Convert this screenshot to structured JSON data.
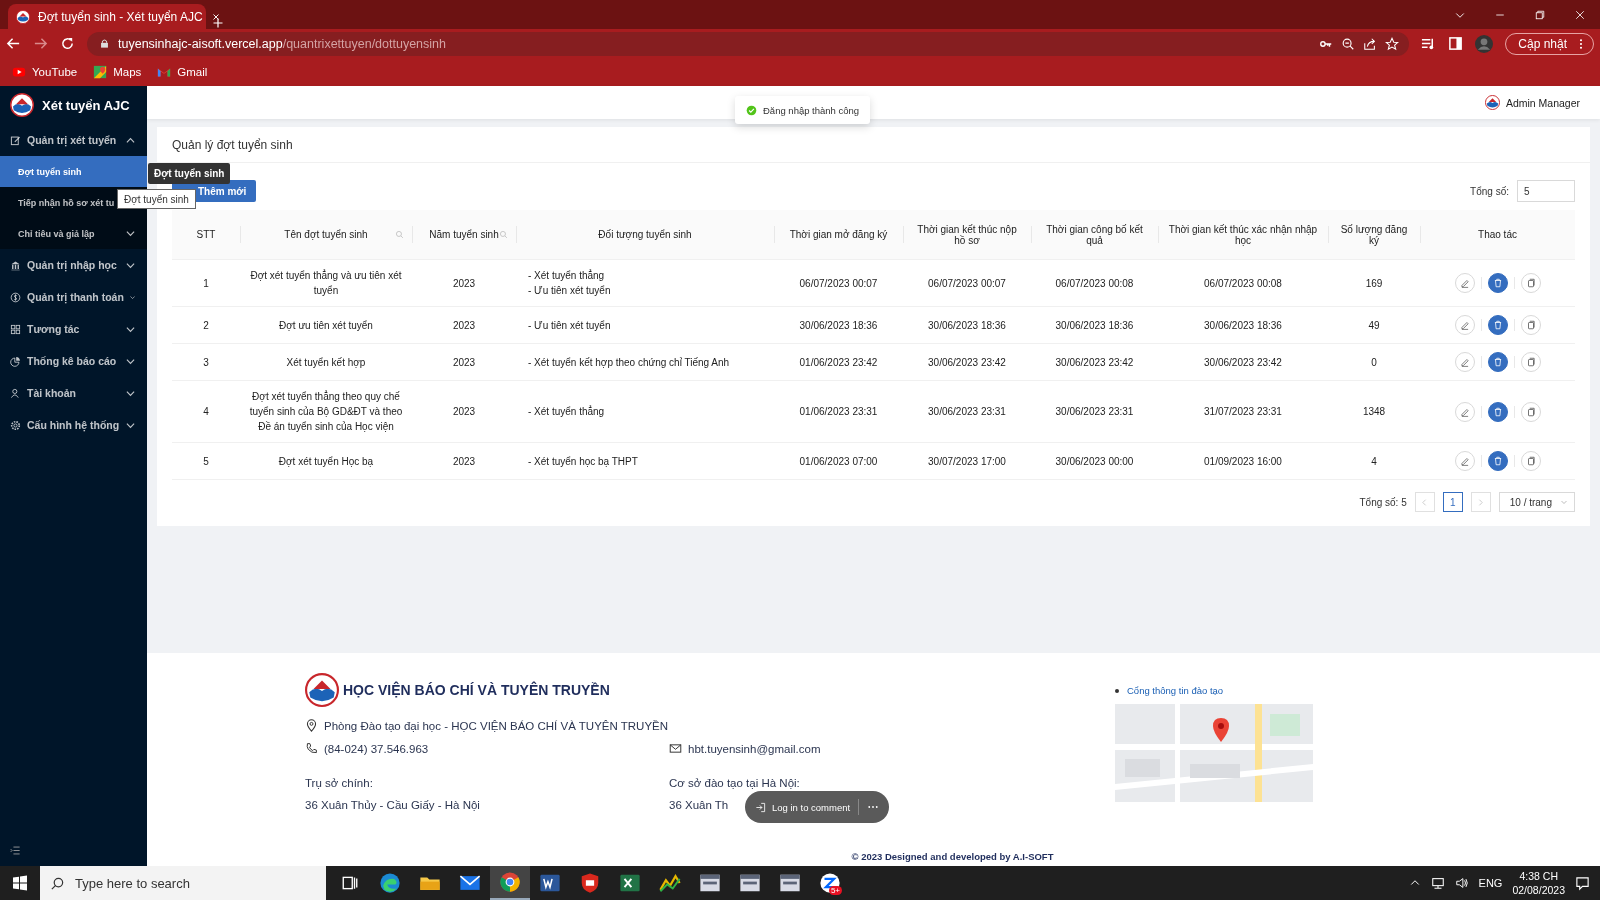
{
  "browser": {
    "tab_title": "Đợt tuyển sinh - Xét tuyển AJC",
    "url_host": "tuyensinhajc-aisoft.vercel.app",
    "url_path": "/quantrixettuyen/dottuyensinh",
    "update_button": "Cập nhật",
    "bookmarks": [
      {
        "label": "YouTube",
        "kind": "youtube"
      },
      {
        "label": "Maps",
        "kind": "maps"
      },
      {
        "label": "Gmail",
        "kind": "gmail"
      }
    ]
  },
  "sidebar": {
    "brand": "Xét tuyển AJC",
    "items": [
      {
        "label": "Quản trị xét tuyển",
        "expanded": true,
        "children": [
          {
            "label": "Đợt tuyển sinh",
            "selected": true,
            "kind": "link"
          },
          {
            "label": "Tiếp nhận hồ sơ xét tu",
            "selected": false,
            "kind": "link"
          },
          {
            "label": "Chỉ tiêu và giả lập",
            "selected": false,
            "kind": "submenu",
            "expanded": false
          }
        ]
      },
      {
        "label": "Quản trị nhập học",
        "expanded": false
      },
      {
        "label": "Quản trị thanh toán",
        "expanded": false
      },
      {
        "label": "Tương tác",
        "expanded": false
      },
      {
        "label": "Thống kê báo cáo",
        "expanded": false
      },
      {
        "label": "Tài khoản",
        "expanded": false
      },
      {
        "label": "Cấu hình hệ thống",
        "expanded": false
      }
    ]
  },
  "menu_tooltip": {
    "text": "Đợt tuyển sinh"
  },
  "title_tooltip": {
    "text": "Đợt tuyển sinh"
  },
  "toast": {
    "text": "Đăng nhập thành công"
  },
  "header": {
    "user": "Admin Manager"
  },
  "card": {
    "title": "Quản lý đợt tuyển sinh",
    "add_button": "Thêm mới",
    "total_label": "Tổng số:",
    "total_value": "5",
    "table": {
      "columns": [
        {
          "label": "STT",
          "searchable": false
        },
        {
          "label": "Tên đợt tuyển sinh",
          "searchable": true
        },
        {
          "label": "Năm tuyển sinh",
          "searchable": true
        },
        {
          "label": "Đối tượng tuyển sinh",
          "searchable": false
        },
        {
          "label": "Thời gian mở đăng ký",
          "searchable": false
        },
        {
          "label": "Thời gian kết thúc nộp hồ sơ",
          "searchable": false
        },
        {
          "label": "Thời gian công bố kết quả",
          "searchable": false
        },
        {
          "label": "Thời gian kết thúc xác nhận nhập học",
          "searchable": false
        },
        {
          "label": "Số lượng đăng ký",
          "searchable": false
        },
        {
          "label": "Thao tác",
          "searchable": false
        }
      ],
      "rows": [
        {
          "stt": "1",
          "name": "Đợt xét tuyển thẳng và ưu tiên xét tuyển",
          "year": "2023",
          "targets": [
            "- Xét tuyển thẳng",
            "- Ưu tiên xét tuyển"
          ],
          "open": "06/07/2023 00:07",
          "submit_end": "06/07/2023 00:07",
          "announce": "06/07/2023 00:08",
          "confirm_end": "06/07/2023 00:08",
          "count": "169"
        },
        {
          "stt": "2",
          "name": "Đợt ưu tiên xét tuyển",
          "year": "2023",
          "targets": [
            "- Ưu tiên xét tuyển"
          ],
          "open": "30/06/2023 18:36",
          "submit_end": "30/06/2023 18:36",
          "announce": "30/06/2023 18:36",
          "confirm_end": "30/06/2023 18:36",
          "count": "49"
        },
        {
          "stt": "3",
          "name": "Xét tuyển kết hợp",
          "year": "2023",
          "targets": [
            "- Xét tuyển kết hợp theo chứng chỉ Tiếng Anh"
          ],
          "open": "01/06/2023 23:42",
          "submit_end": "30/06/2023 23:42",
          "announce": "30/06/2023 23:42",
          "confirm_end": "30/06/2023 23:42",
          "count": "0"
        },
        {
          "stt": "4",
          "name": "Đợt xét tuyển thẳng theo quy chế tuyển sinh của Bộ GD&ĐT và theo Đề án tuyển sinh của Học viện",
          "year": "2023",
          "targets": [
            "- Xét tuyển thẳng"
          ],
          "open": "01/06/2023 23:31",
          "submit_end": "30/06/2023 23:31",
          "announce": "30/06/2023 23:31",
          "confirm_end": "31/07/2023 23:31",
          "count": "1348"
        },
        {
          "stt": "5",
          "name": "Đợt xét tuyển Học bạ",
          "year": "2023",
          "targets": [
            "- Xét tuyển học bạ THPT"
          ],
          "open": "01/06/2023 07:00",
          "submit_end": "30/07/2023 17:00",
          "announce": "30/06/2023 00:00",
          "confirm_end": "01/09/2023 16:00",
          "count": "4"
        }
      ]
    },
    "pagination": {
      "total_text": "Tổng số: 5",
      "pages": [
        {
          "label": "1",
          "selected": true
        }
      ],
      "page_size": "10 / trang"
    }
  },
  "footer": {
    "org": "HỌC VIỆN BÁO CHÍ VÀ TUYÊN TRUYỀN",
    "address": "Phòng Đào tạo đại học - HỌC VIỆN BÁO CHÍ VÀ TUYÊN TRUYỀN",
    "phone": "(84-024) 37.546.963",
    "email": "hbt.tuyensinh@gmail.com",
    "head_office_label": "Trụ sở chính:",
    "head_office": "36 Xuân Thủy - Cầu Giấy - Hà Nội",
    "campus_label": "Cơ sở đào tạo tại Hà Nội:",
    "campus": "36 Xuân Th",
    "portal_link": "Cổng thông tin đào tạo",
    "copyright": "© 2023 Designed and developed by A.I-SOFT"
  },
  "comment_pill": {
    "text": "Log in to comment"
  },
  "taskbar": {
    "search_placeholder": "Type here to search",
    "apps": [
      {
        "kind": "taskview",
        "selected": false
      },
      {
        "kind": "edge",
        "selected": false
      },
      {
        "kind": "explorer",
        "selected": false
      },
      {
        "kind": "mail",
        "selected": false
      },
      {
        "kind": "chrome",
        "selected": true
      },
      {
        "kind": "word",
        "selected": false
      },
      {
        "kind": "shield",
        "selected": false
      },
      {
        "kind": "excel",
        "selected": false
      },
      {
        "kind": "chart",
        "selected": false
      },
      {
        "kind": "window",
        "selected": false
      },
      {
        "kind": "window",
        "selected": false
      },
      {
        "kind": "window",
        "selected": false
      },
      {
        "kind": "chat",
        "selected": false,
        "badge": "5+"
      }
    ],
    "language": "ENG",
    "time": "4:38 CH",
    "date": "02/08/2023"
  }
}
